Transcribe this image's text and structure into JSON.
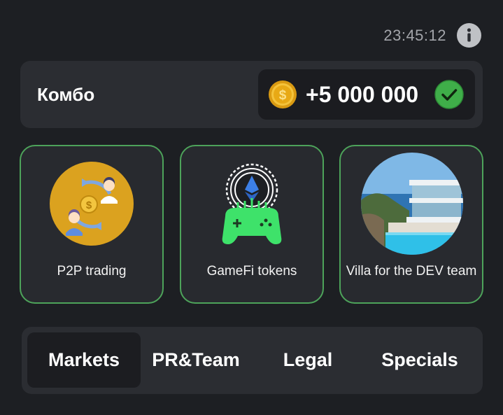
{
  "header": {
    "timer": "23:45:12",
    "info_icon": "info-icon"
  },
  "combo": {
    "title": "Комбо",
    "reward": "+5 000 000",
    "coin_icon": "coin-icon",
    "status_icon": "check-circle-icon",
    "colors": {
      "accent_green": "#4da35a",
      "check_green": "#3fae49",
      "coin_gold": "#e6a817"
    }
  },
  "cards": [
    {
      "label": "P2P trading",
      "icon": "p2p-trading-art"
    },
    {
      "label": "GameFi tokens",
      "icon": "gamepad-ethereum-art"
    },
    {
      "label": "Villa for the DEV team",
      "icon": "villa-art"
    }
  ],
  "tabs": [
    {
      "label": "Markets",
      "active": true
    },
    {
      "label": "PR&Team",
      "active": false
    },
    {
      "label": "Legal",
      "active": false
    },
    {
      "label": "Specials",
      "active": false
    }
  ]
}
